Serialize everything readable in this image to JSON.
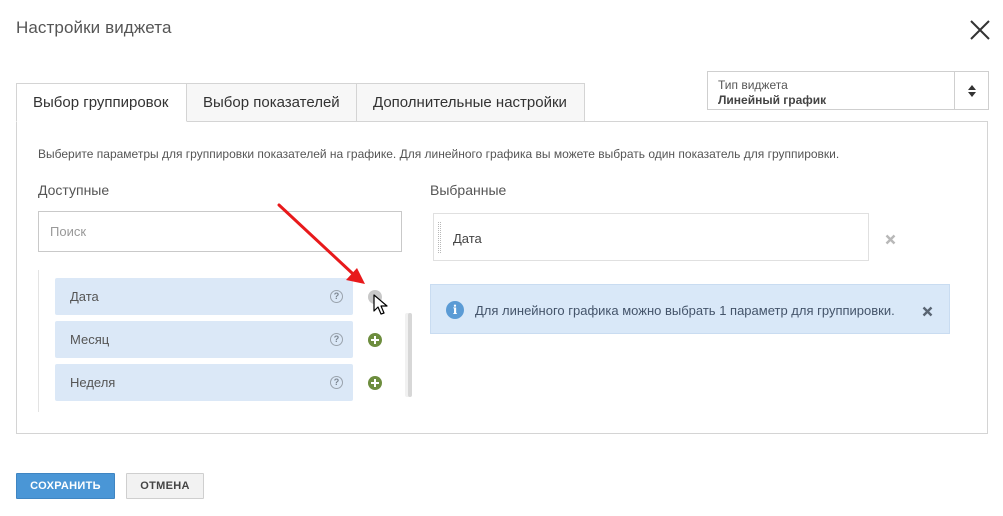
{
  "modal": {
    "title": "Настройки виджета"
  },
  "widget_type": {
    "label": "Тип виджета",
    "value": "Линейный график"
  },
  "tabs": [
    {
      "label": "Выбор группировок",
      "active": true
    },
    {
      "label": "Выбор показателей",
      "active": false
    },
    {
      "label": "Дополнительные настройки",
      "active": false
    }
  ],
  "panel": {
    "description": "Выберите параметры для группировки показателей на графике. Для линейного графика вы можете выбрать один показатель для группировки.",
    "available_label": "Доступные",
    "selected_label": "Выбранные",
    "search_placeholder": "Поиск",
    "search_value": "",
    "available": [
      {
        "label": "Дата",
        "help": "?",
        "add_enabled": false
      },
      {
        "label": "Месяц",
        "help": "?",
        "add_enabled": true
      },
      {
        "label": "Неделя",
        "help": "?",
        "add_enabled": true
      }
    ],
    "selected": [
      {
        "label": "Дата"
      }
    ],
    "info": "Для линейного графика можно выбрать 1 параметр для группировки."
  },
  "footer": {
    "save_label": "СОХРАНИТЬ",
    "cancel_label": "ОТМЕНА"
  },
  "colors": {
    "accent": "#4a96d6",
    "item_bg": "#dbe8f7",
    "add_icon": "#6d8d3e",
    "info_bg": "#d9e8f8",
    "annotation": "#e8191b"
  },
  "icons": [
    "close-icon",
    "sort-arrows-icon",
    "help-icon",
    "add-circle-icon",
    "remove-icon",
    "info-icon",
    "mouse-cursor-icon",
    "annotation-arrow"
  ]
}
